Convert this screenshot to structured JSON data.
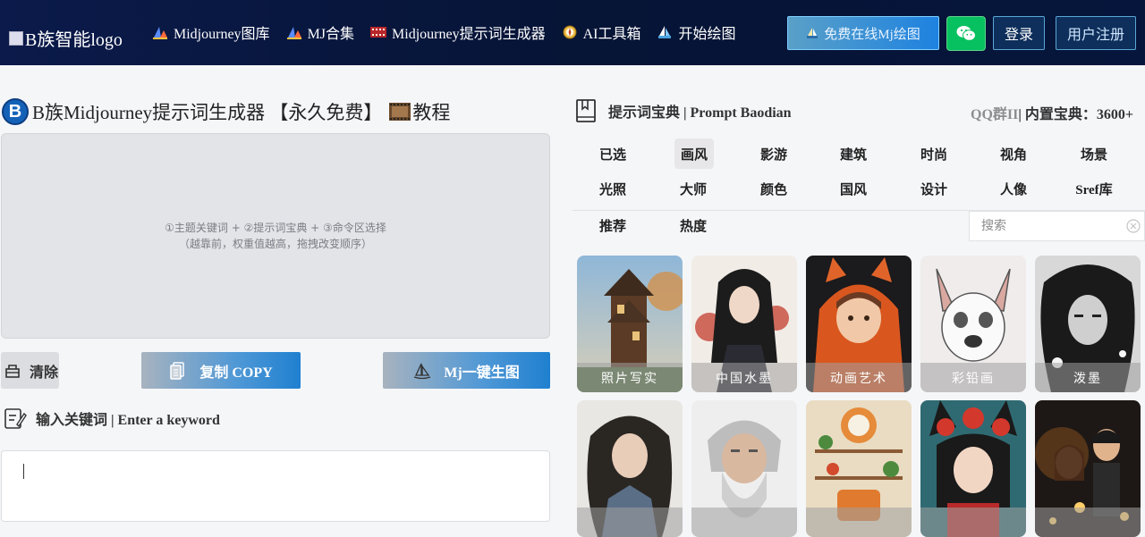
{
  "header": {
    "logo_alt": "B族智能logo",
    "nav": [
      {
        "label": "Midjourney图库",
        "icon": "mj-sail-icon"
      },
      {
        "label": "MJ合集",
        "icon": "mj-sail-icon"
      },
      {
        "label": "Midjourney提示词生成器",
        "icon": "film-icon"
      },
      {
        "label": "AI工具箱",
        "icon": "compass-icon"
      },
      {
        "label": "开始绘图",
        "icon": "sailboat-icon"
      }
    ],
    "free_button": "免费在线Mj绘图",
    "login": "登录",
    "register": "用户注册"
  },
  "left": {
    "logo_letter": "B",
    "title": "B族Midjourney提示词生成器 【永久免费】",
    "tutorial": "教程",
    "drop_hint_1": "①主题关键词 + ②提示词宝典 + ③命令区选择",
    "drop_hint_2": "（越靠前，权重值越高，拖拽改变顺序）",
    "clear_label": "清除",
    "copy_label": "复制 COPY",
    "generate_label": "Mj一键生图",
    "keyword_heading": "输入关键词 | Enter a keyword",
    "keyword_value": ""
  },
  "right": {
    "heading": "提示词宝典 | Prompt Baodian",
    "qq": "QQ群II",
    "builtin": "| 内置宝典：3600+",
    "tabs_row1": [
      "已选",
      "画风",
      "影游",
      "建筑",
      "时尚",
      "视角",
      "场景"
    ],
    "tabs_row2": [
      "光照",
      "大师",
      "颜色",
      "国风",
      "设计",
      "人像",
      "Sref库"
    ],
    "tabs_row3": [
      "推荐",
      "热度"
    ],
    "active_tab": "画风",
    "search_placeholder": "搜索",
    "cards_row1": [
      "照片写实",
      "中国水墨",
      "动画艺术",
      "彩铅画",
      "泼墨"
    ],
    "cards_row2": [
      "",
      "",
      "",
      "",
      ""
    ]
  },
  "colors": {
    "header_bg": "#061436",
    "accent_blue": "#1f80d0",
    "wechat_green": "#07c160"
  }
}
